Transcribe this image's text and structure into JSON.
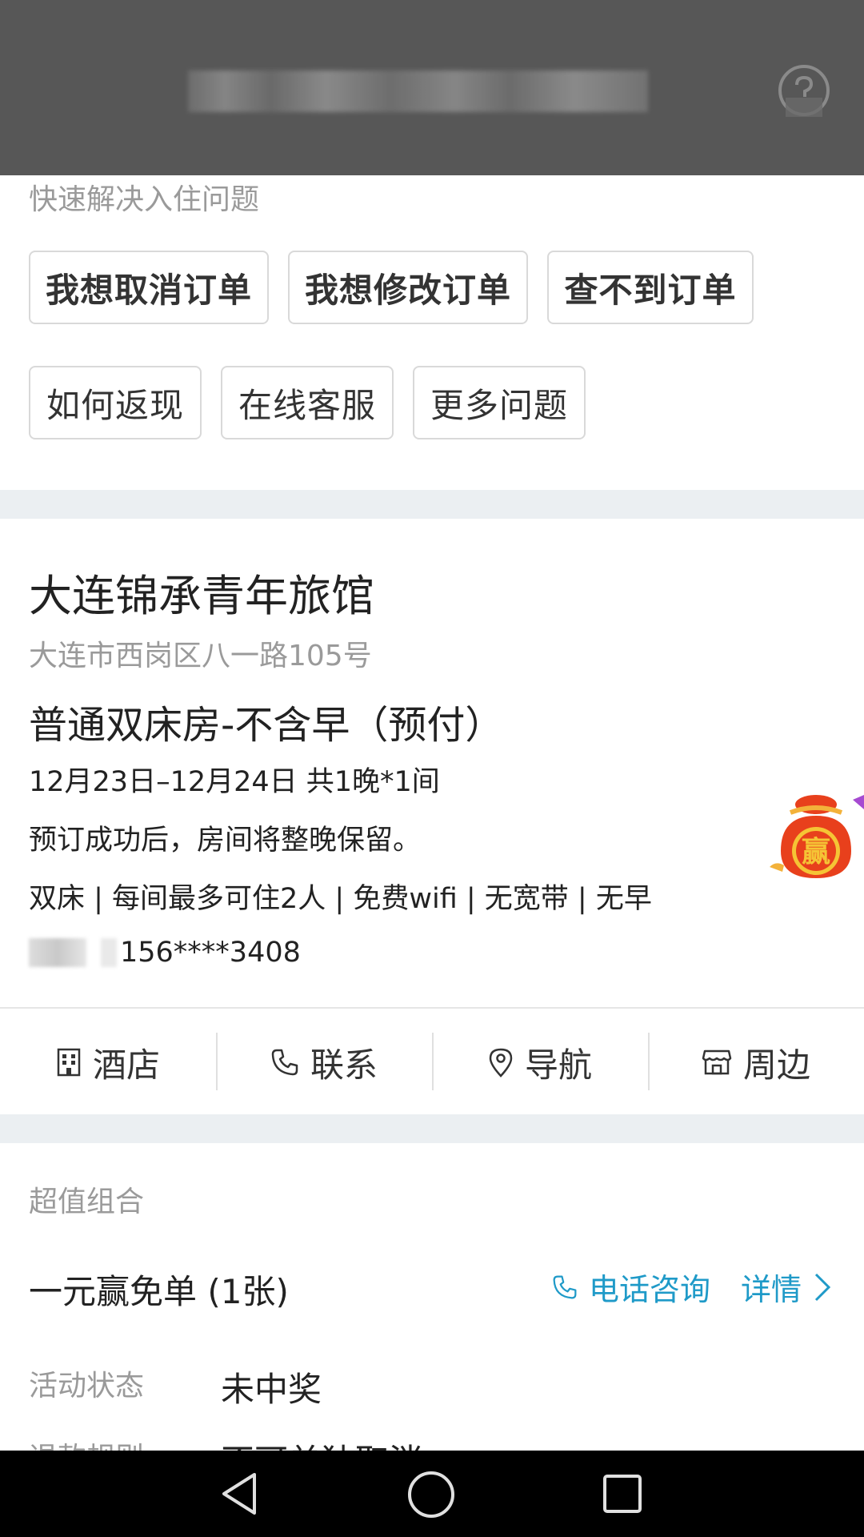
{
  "quick_section": {
    "title": "快速解决入住问题",
    "buttons": [
      {
        "label": "我想取消订单"
      },
      {
        "label": "我想修改订单"
      },
      {
        "label": "查不到订单"
      },
      {
        "label": "如何返现"
      },
      {
        "label": "在线客服"
      },
      {
        "label": "更多问题"
      }
    ]
  },
  "hotel": {
    "name": "大连锦承青年旅馆",
    "address": "大连市西岗区八一路105号",
    "room_type": "普通双床房-不含早（预付）",
    "dates": "12月23日–12月24日 共1晚*1间",
    "policy": "预订成功后，房间将整晚保留。",
    "features": "双床 | 每间最多可住2人 | 免费wifi | 无宽带 | 无早",
    "phone_masked": "156****3408"
  },
  "actions": [
    {
      "label": "酒店",
      "icon": "building-icon"
    },
    {
      "label": "联系",
      "icon": "phone-icon"
    },
    {
      "label": "导航",
      "icon": "location-pin-icon"
    },
    {
      "label": "周边",
      "icon": "shop-icon"
    }
  ],
  "combo": {
    "section_title": "超值组合",
    "name": "一元赢免单 (1张)",
    "phone_consult": "电话咨询",
    "details": "详情",
    "status_label": "活动状态",
    "status_value": "未中奖",
    "refund_label": "退款规则",
    "refund_value": "不可单独取消"
  },
  "promo_badge": {
    "text": "赢"
  },
  "colors": {
    "header_bg": "#575757",
    "link_blue": "#1f9ac8",
    "section_gap": "#ebeff2",
    "promo_red": "#e8401c"
  }
}
